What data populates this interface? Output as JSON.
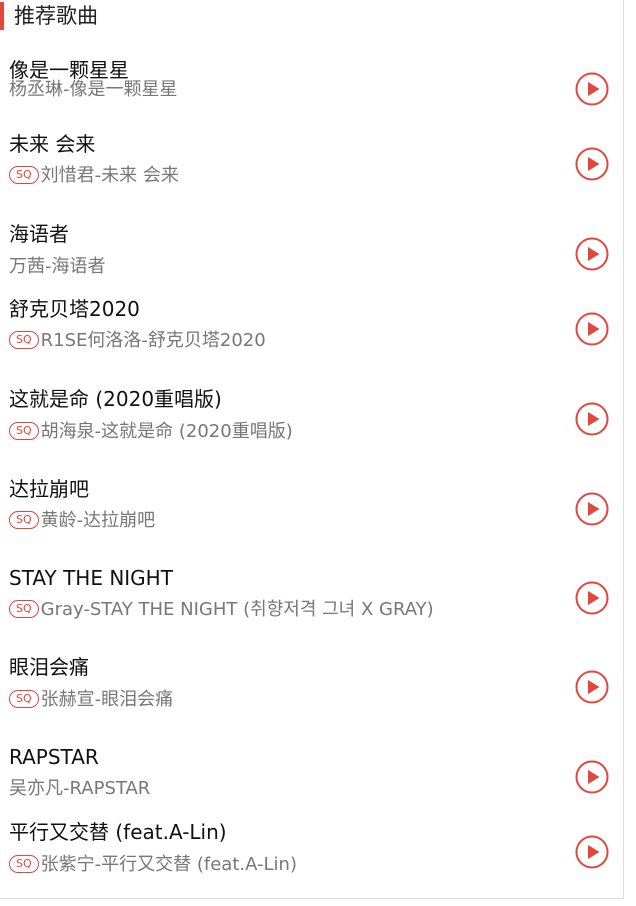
{
  "header": {
    "title": "推荐歌曲"
  },
  "badge_label": "SQ",
  "colors": {
    "accent": "#e2463c"
  },
  "songs": [
    {
      "title": "像是一颗星星",
      "artist": "杨丞琳",
      "album": "像是一颗星星",
      "sq": false,
      "icon": "play-circle-icon"
    },
    {
      "title": "未来 会来",
      "artist": "刘惜君",
      "album": "未来 会来",
      "sq": true,
      "icon": "play-circle-icon"
    },
    {
      "title": "海语者",
      "artist": "万茜",
      "album": "海语者",
      "sq": false,
      "icon": "play-circle-icon"
    },
    {
      "title": "舒克贝塔2020",
      "artist": "R1SE何洛洛",
      "album": "舒克贝塔2020",
      "sq": true,
      "icon": "play-circle-icon"
    },
    {
      "title": "这就是命 (2020重唱版)",
      "artist": "胡海泉",
      "album": "这就是命 (2020重唱版)",
      "sq": true,
      "icon": "play-circle-icon"
    },
    {
      "title": "达拉崩吧",
      "artist": "黄龄",
      "album": "达拉崩吧",
      "sq": true,
      "icon": "play-circle-icon"
    },
    {
      "title": "STAY THE NIGHT",
      "artist": "Gray",
      "album": "STAY THE NIGHT (취향저격 그녀 X GRAY)",
      "sq": true,
      "icon": "play-circle-icon"
    },
    {
      "title": "眼泪会痛",
      "artist": "张赫宣",
      "album": "眼泪会痛",
      "sq": true,
      "icon": "play-circle-icon"
    },
    {
      "title": "RAPSTAR",
      "artist": "吴亦凡",
      "album": "RAPSTAR",
      "sq": false,
      "icon": "play-circle-icon"
    },
    {
      "title": "平行又交替 (feat.A-Lin)",
      "artist": "张紫宁",
      "album": "平行又交替 (feat.A-Lin)",
      "sq": true,
      "icon": "play-circle-icon"
    }
  ]
}
